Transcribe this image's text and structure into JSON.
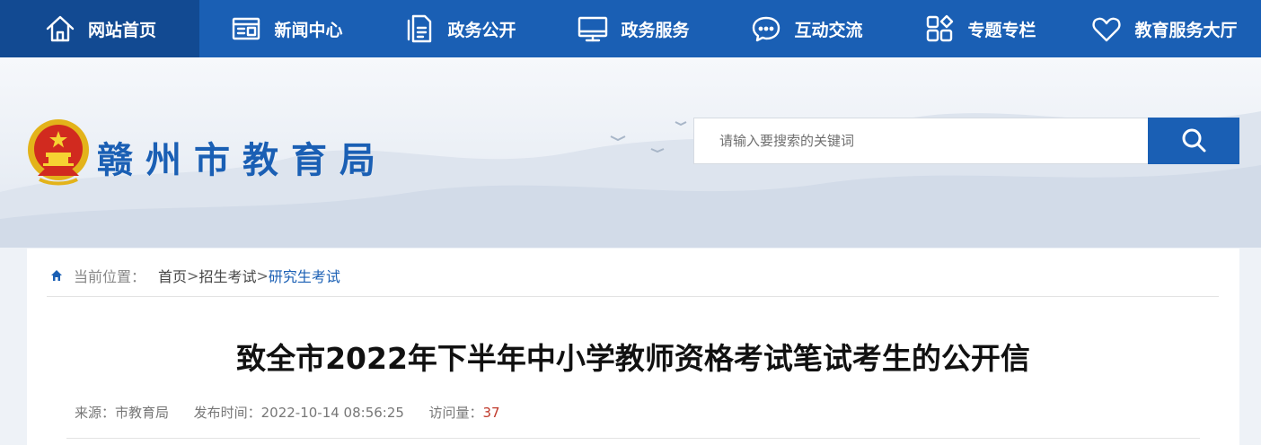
{
  "nav": {
    "items": [
      {
        "label": "网站首页",
        "icon": "home-icon"
      },
      {
        "label": "新闻中心",
        "icon": "news-icon"
      },
      {
        "label": "政务公开",
        "icon": "document-icon"
      },
      {
        "label": "政务服务",
        "icon": "monitor-icon"
      },
      {
        "label": "互动交流",
        "icon": "chat-bubble-icon"
      },
      {
        "label": "专题专栏",
        "icon": "grid-icon"
      },
      {
        "label": "教育服务大厅",
        "icon": "heart-icon"
      }
    ],
    "active_index": 0
  },
  "header": {
    "site_title": "赣州市教育局",
    "emblem": "national-emblem",
    "search": {
      "placeholder": "请输入要搜索的关键词",
      "value": ""
    },
    "search_button_icon": "search-icon"
  },
  "breadcrumb": {
    "label": "当前位置：",
    "items": [
      "首页",
      "招生考试",
      "研究生考试"
    ],
    "separator": ">"
  },
  "article": {
    "title": "致全市2022年下半年中小学教师资格考试笔试考生的公开信",
    "source_label": "来源：",
    "source": "市教育局",
    "time_label": "发布时间：",
    "time": "2022-10-14 08:56:25",
    "views_label": "访问量：",
    "views": "37"
  },
  "colors": {
    "primary": "#1a5fb4",
    "nav_active": "#124a92",
    "views": "#c0392b"
  }
}
